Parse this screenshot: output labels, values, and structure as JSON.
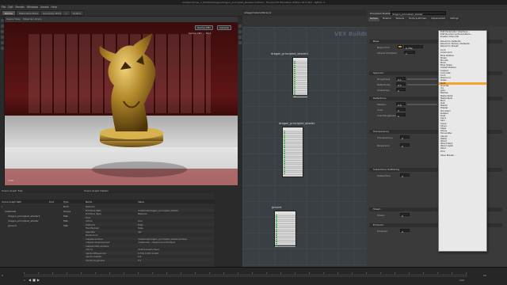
{
  "app": {
    "title": "/mnt/arch/rive_ir_fx/2024/dragon/dragon_principled_shader/ch/stone - Houdini FX Education Edition 19.5.303 - Python 3"
  },
  "menubar": {
    "items": [
      "File",
      "Edit",
      "Render",
      "Windows",
      "Assets",
      "Help"
    ]
  },
  "shelf": {
    "tabs": [
      "Karma",
      "Materialist Bldrs",
      "Geometry Bldrs",
      "+",
      "Solaris",
      "Build",
      "Material Palette"
    ]
  },
  "viewport": {
    "tab": "Scene View",
    "label": "Material Library",
    "overlay_text": "Karma CPU — 36.4",
    "res_label": "Render Region",
    "buttons": [
      "Karma XPU",
      "Camera"
    ],
    "render_time": "0:06"
  },
  "network": {
    "tabs": [
      "/stage/materiallibrary1",
      "Material Palette",
      "+"
    ],
    "title_watermark": "VEX Builder",
    "nodes": [
      {
        "label": "dragon_principled_shader1",
        "ports": 18
      },
      {
        "label": "dragon_principled_shader",
        "ports": 22
      },
      {
        "label": "ground",
        "ports": 16
      }
    ]
  },
  "params": {
    "node_type": "Principled Shader",
    "node_name": "dragon_principled_shader",
    "tabs": [
      "Surface",
      "Material",
      "Textures",
      "Bump & Normals",
      "Displacement",
      "Settings"
    ],
    "sections": [
      "Base",
      "Specular",
      "Reflections",
      "Transparency",
      "Subsurface Scattering",
      "Sheen",
      "Emission"
    ],
    "fields": [
      {
        "label": "Base Color",
        "value": "0.759"
      },
      {
        "label": "Albedo Multiplier",
        "value": "1"
      },
      {
        "label": "Roughness",
        "value": "0.1"
      },
      {
        "label": "Reflectivity",
        "value": "0.5"
      },
      {
        "label": "Anisotropy",
        "value": "0"
      },
      {
        "label": "Metallic",
        "value": "0.6"
      },
      {
        "label": "Coat",
        "value": "0"
      },
      {
        "label": "Coat Roughness",
        "value": "0"
      },
      {
        "label": "Transparency",
        "value": "0"
      },
      {
        "label": "Dispersion",
        "value": "0"
      },
      {
        "label": "Subsurface",
        "value": "0"
      },
      {
        "label": "Sheen",
        "value": "0"
      },
      {
        "label": "Emission",
        "value": "0"
      }
    ]
  },
  "dropdown": {
    "items": [
      "Edit Parameter Interface...",
      "Edit Rendering Parameters...",
      "Delete Channels",
      "",
      "Revert to Defaults",
      "Revert to Factory Defaults",
      "Revert to Preset",
      "",
      "Lock",
      "Aluminium",
      "Blue Rubber",
      "Brass",
      "Bronze",
      "Brick",
      "Blue Shale",
      "Cobalt Rubber",
      "Copper",
      "Concrete",
      "Cork",
      "Diamond",
      "Glass",
      "Gold",
      "Granite",
      "Ice",
      "Jade",
      "Marble",
      "Metal Paint",
      "Metal Rust",
      "Mud",
      "Oak",
      "Plastic",
      "Plaster",
      "Porcelain",
      "Rubber",
      "Rust",
      "Sand",
      "Skin",
      "Snow",
      "Silver",
      "Steel",
      "Stone",
      "Terracotta",
      "Velvet",
      "Water",
      "Wood",
      "Wood Dark",
      "Wood Light",
      "Wool",
      "Zinc",
      "",
      "Save Preset..."
    ],
    "selected": "Gold"
  },
  "scene_graph": {
    "tabs": [
      "Scene Graph Tree",
      "Scene Graph Details",
      "+"
    ],
    "header": [
      "Scene Graph Path",
      "Kind",
      "Type"
    ],
    "rows": [
      {
        "path": "/",
        "kind": "",
        "type": "Root"
      },
      {
        "path": "materials",
        "kind": "",
        "type": "Scope"
      },
      {
        "path": "dragon_principled_shader1",
        "kind": "",
        "type": "Mat."
      },
      {
        "path": "dragon_principled_shader",
        "kind": "",
        "type": "Mat."
      },
      {
        "path": "ground",
        "kind": "",
        "type": "Mat."
      }
    ]
  },
  "details": {
    "header": [
      "Name",
      "Value"
    ],
    "rows": [
      [
        "Material",
        ""
      ],
      [
        "Primitive Path",
        "/materials/dragon_principled_shader"
      ],
      [
        "Primitive Type",
        "Material"
      ],
      [
        "Kind",
        ""
      ],
      [
        "Active",
        "true"
      ],
      [
        "Instance",
        "false"
      ],
      [
        "Has Payload",
        "false"
      ],
      [
        "Specifier",
        "def"
      ],
      [
        "Model Kind",
        ""
      ],
      [
        "outputs:surface",
        "/materials/dragon_principled_shader.surface"
      ],
      [
        "outputs:displacement",
        "/materials/.../displacementOutput"
      ],
      [
        "outputs:mtlx:surface",
        ""
      ],
      [
        "info:id",
        "UsdPreviewSurface"
      ],
      [
        "inputs:diffuseColor",
        "0.759 0.553 0.168"
      ],
      [
        "inputs:metallic",
        "0.6"
      ],
      [
        "inputs:roughness",
        "0.1"
      ]
    ]
  },
  "timeline": {
    "frame": "1",
    "start": "1",
    "end": "240",
    "fps": "24"
  },
  "colors": {
    "accent": "#f4a22e",
    "viewport_bg": "#4a1010",
    "dragon_gold": "#b48a2c",
    "network_bg": "#3a3f44"
  }
}
